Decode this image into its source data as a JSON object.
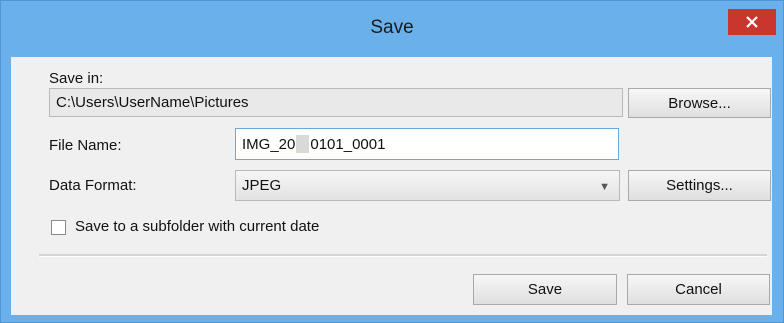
{
  "dialog": {
    "title": "Save",
    "close_icon_name": "close-icon",
    "accent_color": "#6ab0ea",
    "close_color": "#c9362d"
  },
  "save_in": {
    "label": "Save in:",
    "path": "C:\\Users\\UserName\\Pictures",
    "browse_label": "Browse..."
  },
  "file_name": {
    "label": "File Name:",
    "value_prefix": "IMG_20",
    "value_suffix": "0101_0001"
  },
  "data_format": {
    "label": "Data Format:",
    "selected": "JPEG",
    "settings_label": "Settings..."
  },
  "subfolder": {
    "label": "Save to a subfolder with current date",
    "checked": false
  },
  "actions": {
    "save_label": "Save",
    "cancel_label": "Cancel"
  }
}
